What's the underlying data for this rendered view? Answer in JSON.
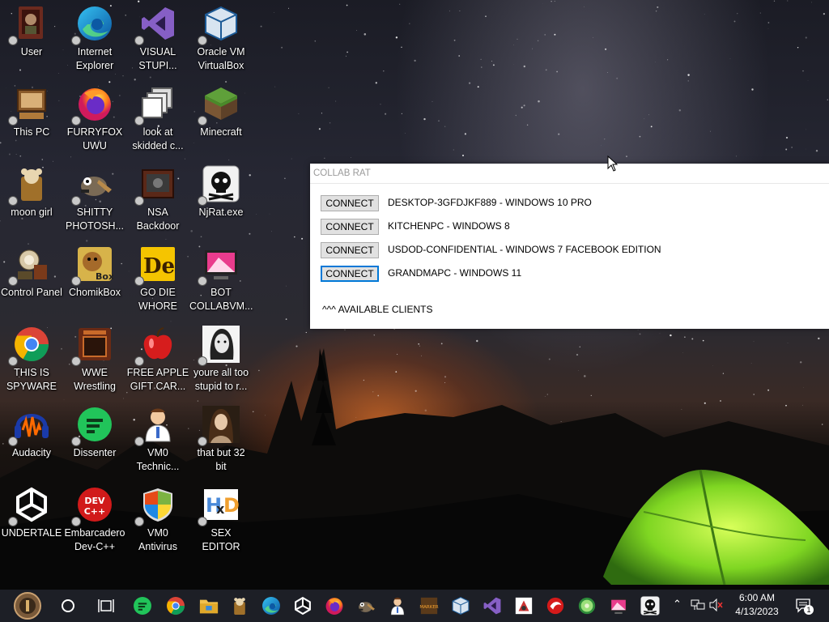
{
  "desktop": {
    "icons": [
      {
        "label": "User",
        "icon": "user-folder-icon"
      },
      {
        "label": "Internet\nExplorer",
        "icon": "edge-icon"
      },
      {
        "label": "VISUAL\nSTUPI...",
        "icon": "visual-studio-icon"
      },
      {
        "label": "Oracle VM\nVirtualBox",
        "icon": "virtualbox-icon"
      },
      {
        "label": "This PC",
        "icon": "computer-icon"
      },
      {
        "label": "FURRYFOX\nUWU",
        "icon": "firefox-icon"
      },
      {
        "label": "look at\nskidded c...",
        "icon": "copy-windows-icon"
      },
      {
        "label": "Minecraft",
        "icon": "minecraft-grass-block-icon"
      },
      {
        "label": "moon girl",
        "icon": "moon-girl-icon"
      },
      {
        "label": "SHITTY\nPHOTOSH...",
        "icon": "gimp-icon"
      },
      {
        "label": "NSA\nBackdoor",
        "icon": "nsa-backdoor-icon"
      },
      {
        "label": "NjRat.exe",
        "icon": "skull-icon"
      },
      {
        "label": "Control Panel",
        "icon": "control-panel-icon"
      },
      {
        "label": "ChomikBox",
        "icon": "chomikbox-icon"
      },
      {
        "label": "GO DIE\nWHORE",
        "icon": "de-document-icon"
      },
      {
        "label": "BOT\nCOLLABVM...",
        "icon": "bot-screen-icon"
      },
      {
        "label": "THIS IS\nSPYWARE",
        "icon": "chrome-icon"
      },
      {
        "label": "WWE\nWrestling",
        "icon": "oven-icon"
      },
      {
        "label": "FREE APPLE\nGIFT CAR...",
        "icon": "apple-icon"
      },
      {
        "label": "youre all too\nstupid to r...",
        "icon": "portrait-sketch-icon"
      },
      {
        "label": "Audacity",
        "icon": "audacity-icon"
      },
      {
        "label": "Dissenter",
        "icon": "dissenter-icon"
      },
      {
        "label": "VM0\nTechnic...",
        "icon": "doctor-icon"
      },
      {
        "label": "that but 32\nbit",
        "icon": "portrait-painting-icon"
      },
      {
        "label": "UNDERTALE",
        "icon": "unity-icon"
      },
      {
        "label": "Embarcadero\nDev-C++",
        "icon": "devcpp-icon"
      },
      {
        "label": "VM0\nAntivirus",
        "icon": "shield-icon"
      },
      {
        "label": "SEX\nEDITOR",
        "icon": "hxd-icon"
      }
    ]
  },
  "rat_window": {
    "title": "COLLAB RAT",
    "clients": [
      {
        "button": "CONNECT",
        "name": "DESKTOP-3GFDJKF889 - WINDOWS 10 PRO"
      },
      {
        "button": "CONNECT",
        "name": "KITCHENPC - WINDOWS 8"
      },
      {
        "button": "CONNECT",
        "name": "USDOD-CONFIDENTIAL - WINDOWS 7 FACEBOOK EDITION"
      },
      {
        "button": "CONNECT",
        "name": "GRANDMAPC - WINDOWS 11"
      }
    ],
    "footer": "^^^ AVAILABLE CLIENTS"
  },
  "taskbar": {
    "items": [
      "start-icon",
      "cortana-circle-icon",
      "task-view-icon",
      "dissenter-icon",
      "chrome-icon",
      "file-explorer-icon",
      "moon-girl-icon",
      "edge-icon",
      "unity-icon",
      "firefox-icon",
      "gimp-icon",
      "doctor-icon",
      "marker-icon",
      "virtualbox-icon",
      "visual-studio-icon",
      "java-icon",
      "red-bird-icon",
      "watermelon-icon",
      "bot-screen-icon",
      "skull-icon"
    ],
    "time": "6:00 AM",
    "date": "4/13/2023",
    "notification_count": "1"
  },
  "colors": {
    "accent": "#0078d7",
    "taskbar": "#1d1f26",
    "button_face": "#e1e1e1"
  }
}
